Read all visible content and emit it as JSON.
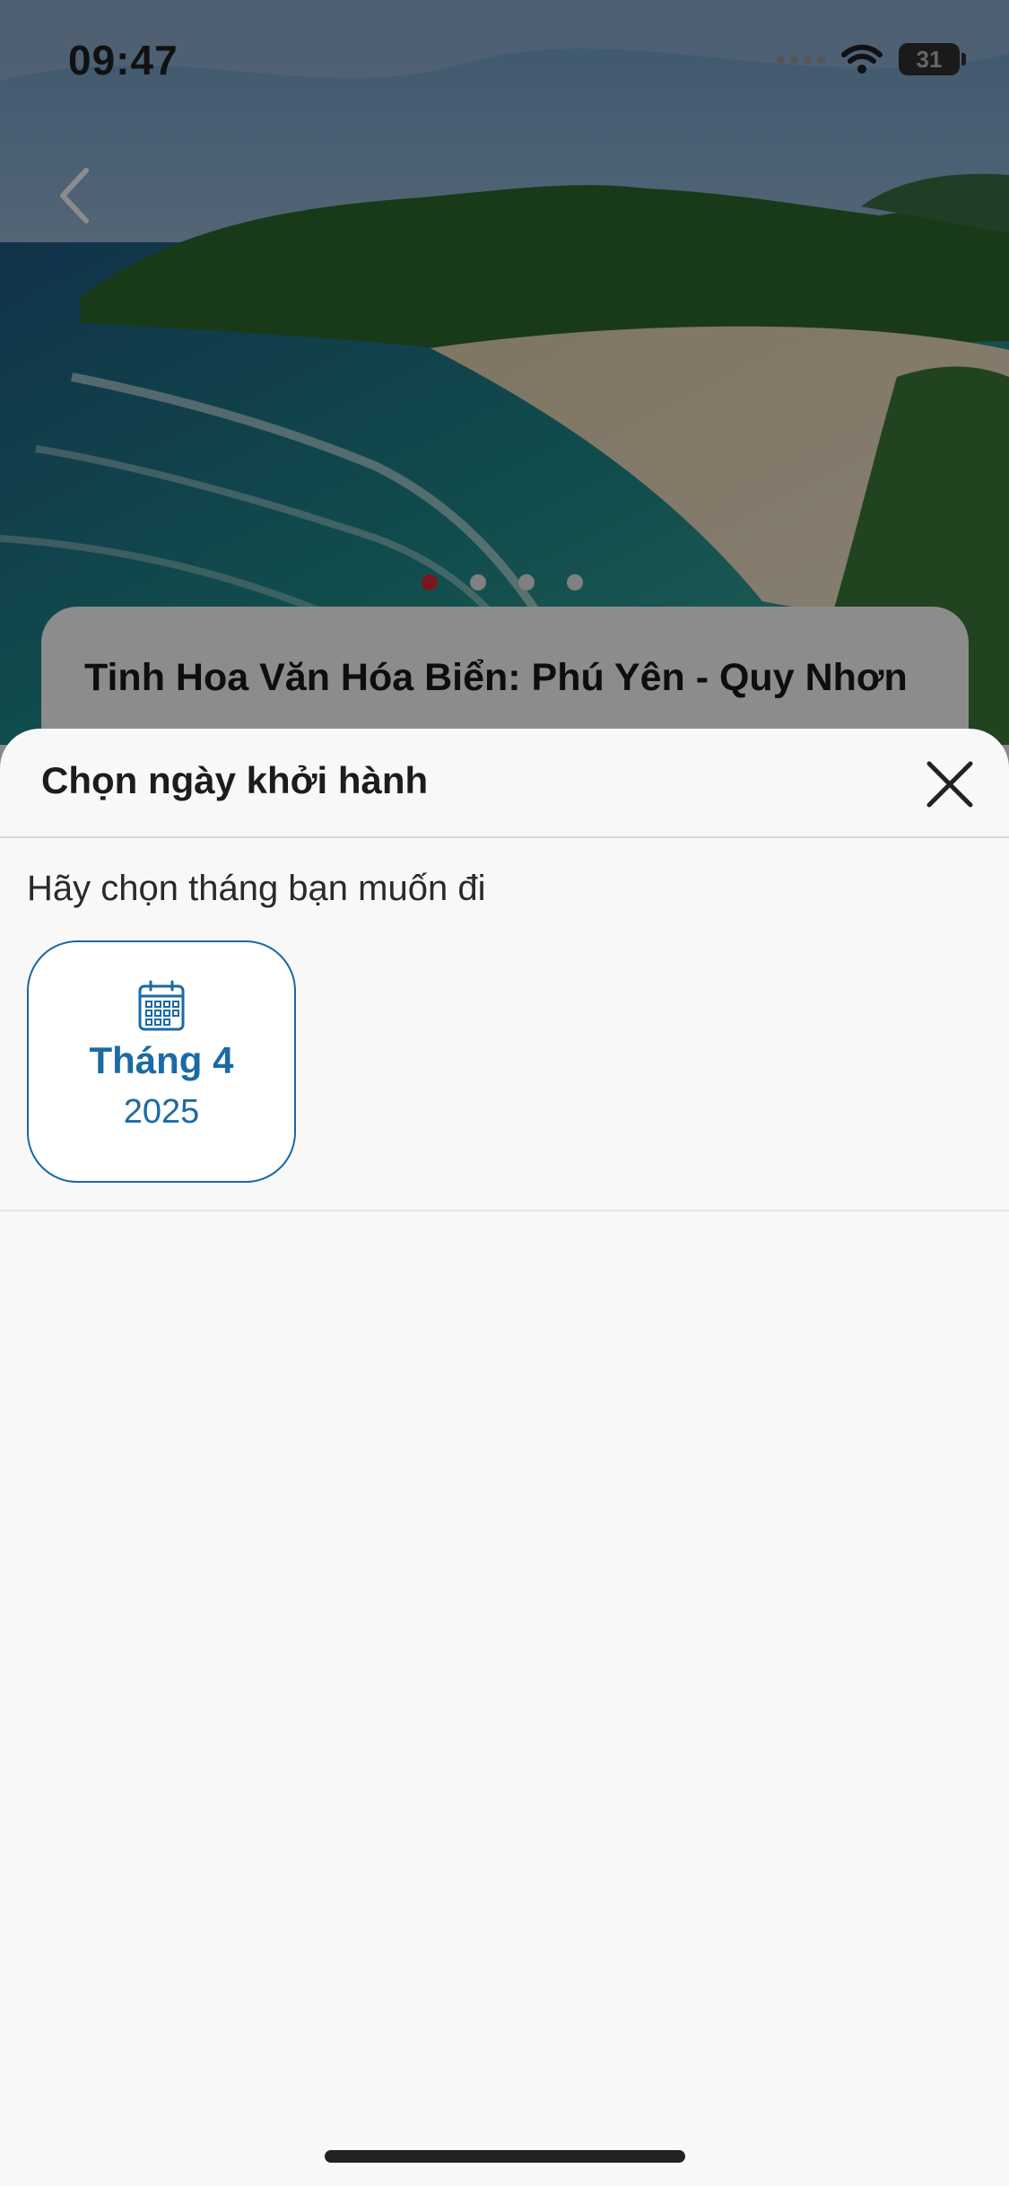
{
  "status_bar": {
    "time": "09:47",
    "battery": "31"
  },
  "tour": {
    "title": "Tinh Hoa Văn Hóa Biển: Phú Yên - Quy Nhơn",
    "carousel": {
      "count": 4,
      "active_index": 0
    }
  },
  "sheet": {
    "title": "Chọn ngày khởi hành",
    "prompt": "Hãy chọn tháng bạn muốn đi",
    "months": [
      {
        "month": "Tháng 4",
        "year": "2025"
      }
    ]
  },
  "colors": {
    "accent_blue": "#1b6aa6",
    "active_dot": "#e0293b"
  },
  "icons": {
    "back": "chevron-left-icon",
    "close": "close-icon",
    "calendar": "calendar-icon"
  }
}
